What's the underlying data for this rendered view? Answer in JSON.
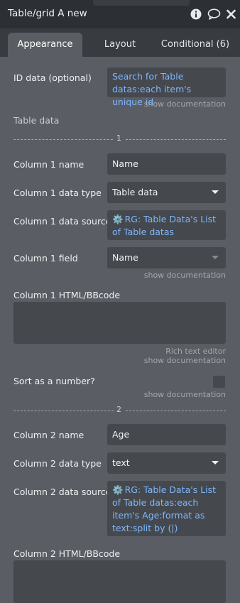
{
  "header": {
    "title": "Table/grid A new",
    "icons": [
      "info-icon",
      "comment-icon",
      "close-icon"
    ]
  },
  "tabs": [
    {
      "label": "Appearance",
      "active": true
    },
    {
      "label": "Layout",
      "active": false
    },
    {
      "label": "Conditional (6)",
      "active": false
    }
  ],
  "fields": {
    "id_data_label": "ID data (optional)",
    "id_data_value": "Search for Table datas:each item's unique id",
    "table_data_label": "Table data",
    "show_doc": "show documentation",
    "rich_text_editor": "Rich text editor",
    "sort_label": "Sort as a number?"
  },
  "column1": {
    "separator": "1",
    "name_label": "Column 1 name",
    "name_value": "Name",
    "type_label": "Column 1 data type",
    "type_value": "Table data",
    "source_label": "Column 1 data source",
    "source_value": "RG: Table Data's List of Table datas",
    "field_label": "Column 1 field",
    "field_value": "Name",
    "html_label": "Column 1 HTML/BBcode"
  },
  "column2": {
    "separator": "2",
    "name_label": "Column 2 name",
    "name_value": "Age",
    "type_label": "Column 2 data type",
    "type_value": "text",
    "source_label": "Column 2 data source",
    "source_value": "RG: Table Data's List of Table datas:each item's Age:format as text:split by (|)",
    "html_label": "Column 2 HTML/BBcode"
  },
  "colors": {
    "panel_bg": "#5a5d63",
    "header_bg": "#2c2f34",
    "input_bg": "#45484d",
    "dynamic_text": "#7fb7ff"
  }
}
